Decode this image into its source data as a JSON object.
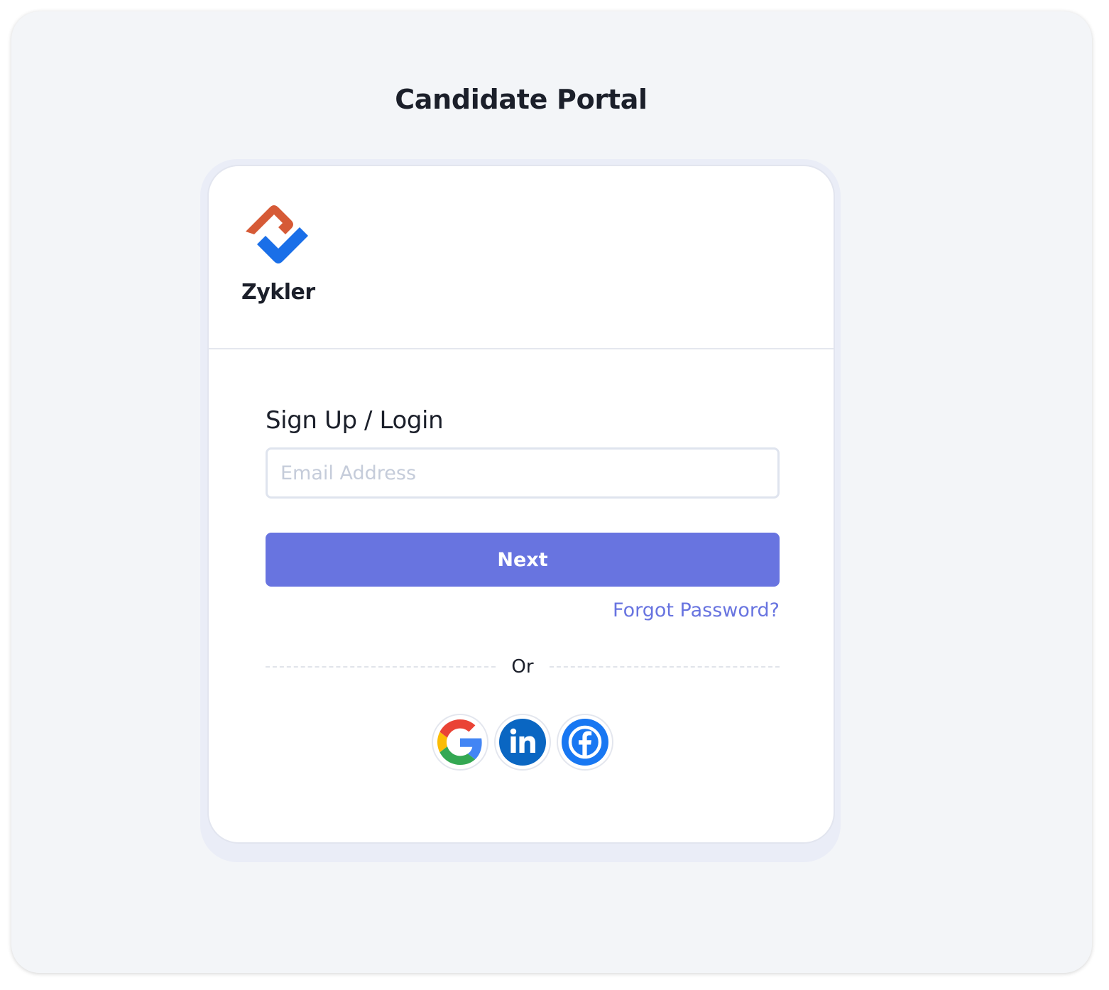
{
  "page": {
    "title": "Candidate Portal"
  },
  "brand": {
    "name": "Zykler",
    "logo_icon": "zykler-logo-icon",
    "logo_colors": [
      "#d65a36",
      "#1a6fe8"
    ]
  },
  "form": {
    "heading": "Sign Up / Login",
    "email_placeholder": "Email Address",
    "email_value": "",
    "next_label": "Next",
    "forgot_label": "Forgot Password?",
    "divider_label": "Or"
  },
  "social": [
    {
      "name": "google",
      "icon": "google-icon"
    },
    {
      "name": "linkedin",
      "icon": "linkedin-icon",
      "color": "#0a66c2"
    },
    {
      "name": "facebook",
      "icon": "facebook-icon",
      "color": "#1877f2"
    }
  ],
  "colors": {
    "accent": "#6874e0",
    "background": "#f3f5f8",
    "text": "#1b1f2a"
  }
}
